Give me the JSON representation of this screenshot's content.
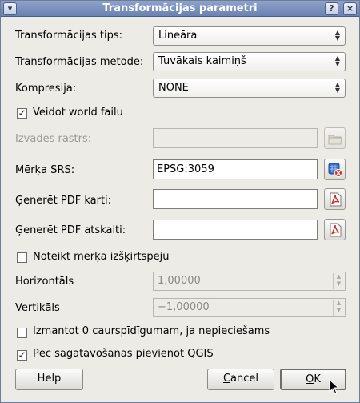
{
  "window": {
    "title": "Transformācijas parametri",
    "menu_glyph": "▾",
    "help_glyph": "?",
    "close_glyph": "×"
  },
  "form": {
    "transform_type": {
      "label": "Transformācijas tips:",
      "value": "Lineāra"
    },
    "transform_method": {
      "label": "Transformācijas metode:",
      "value": "Tuvākais kaimiņš"
    },
    "compression": {
      "label": "Kompresija:",
      "value": "NONE"
    },
    "world_file": {
      "label": "Veidot world failu",
      "checked": true
    },
    "output_raster": {
      "label": "Izvades rastrs:",
      "value": "",
      "disabled": true
    },
    "target_srs": {
      "label": "Mērķa SRS:",
      "value": "EPSG:3059"
    },
    "pdf_map": {
      "label": "Ģenerēt PDF karti:",
      "value": ""
    },
    "pdf_report": {
      "label": "Ģenerēt PDF atskaiti:",
      "value": ""
    },
    "set_resolution": {
      "label": "Noteikt mērķa izšķirtspēju",
      "checked": false
    },
    "horizontal": {
      "label": "Horizontāls",
      "value": "1,00000"
    },
    "vertical": {
      "label": "Vertikāls",
      "value": "−1,00000"
    },
    "use_zero_transparency": {
      "label": "Izmantot 0 caurspīdīgumam, ja nepieciešams",
      "checked": false
    },
    "load_in_qgis": {
      "label": "Pēc sagatavošanas pievienot QGIS",
      "checked": true
    }
  },
  "buttons": {
    "help": "Help",
    "cancel_mnemonic": "C",
    "cancel_rest": "ancel",
    "ok_mnemonic": "O",
    "ok_rest": "K"
  },
  "glyphs": {
    "check": "✓",
    "up": "▲",
    "down": "▼"
  }
}
